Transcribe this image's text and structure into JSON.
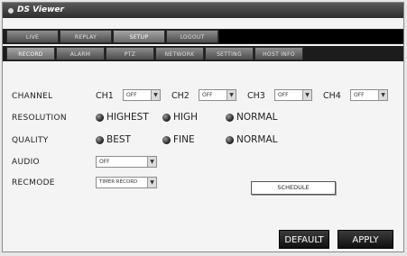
{
  "window": {
    "title": "DS Viewer"
  },
  "main_tabs": [
    "LIVE",
    "REPLAY",
    "SETUP",
    "LOGOUT"
  ],
  "sub_tabs": [
    "RECORD",
    "ALARM",
    "PTZ",
    "NETWORK",
    "SETTING",
    "HOST INFO"
  ],
  "form": {
    "channel": {
      "label": "CHANNEL",
      "channels": [
        {
          "name": "CH1",
          "value": "OFF"
        },
        {
          "name": "CH2",
          "value": "OFF"
        },
        {
          "name": "CH3",
          "value": "OFF"
        },
        {
          "name": "CH4",
          "value": "OFF"
        }
      ]
    },
    "resolution": {
      "label": "RESOLUTION",
      "options": [
        "HIGHEST",
        "HIGH",
        "NORMAL"
      ]
    },
    "quality": {
      "label": "QUALITY",
      "options": [
        "BEST",
        "FINE",
        "NORMAL"
      ]
    },
    "audio": {
      "label": "AUDIO",
      "value": "OFF"
    },
    "recmode": {
      "label": "RECMODE",
      "value": "TIMER RECORD"
    },
    "schedule_button": "SCHEDULE"
  },
  "buttons": {
    "default": "DEFAULT",
    "apply": "APPLY"
  },
  "icons": {
    "dropdown_arrow": "▼"
  }
}
